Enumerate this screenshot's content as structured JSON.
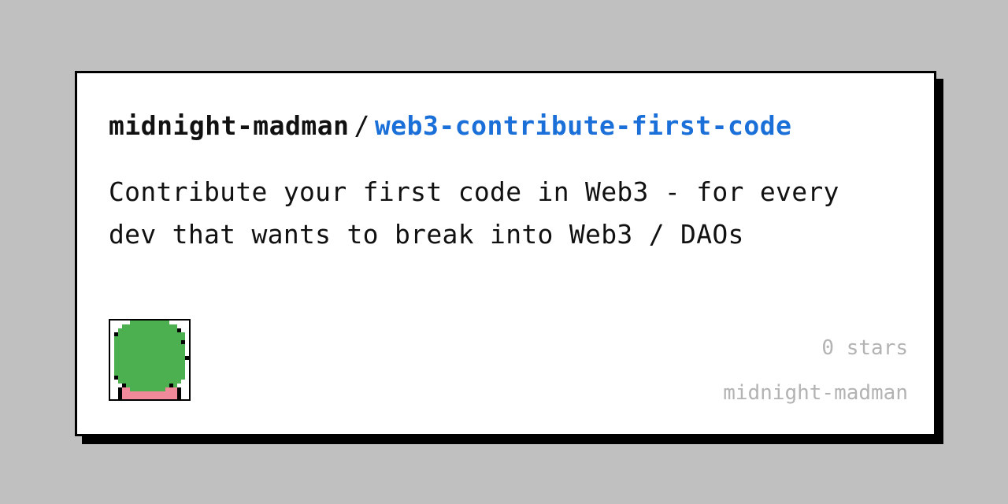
{
  "card": {
    "owner": "midnight-madman",
    "separator": "/",
    "repo_name": "web3-contribute-first-code",
    "description": "Contribute your first code in Web3 - for every dev that wants to break into Web3 / DAOs",
    "stars": "0 stars",
    "username": "midnight-madman",
    "avatar_icon": "pixel-avatar-icon"
  },
  "colors": {
    "background": "#c0c0c0",
    "card": "#ffffff",
    "border": "#000000",
    "repo_link": "#1b6fd8",
    "muted_text": "#b3b3b3",
    "avatar_green": "#4caf50",
    "avatar_pink": "#f08a9a"
  }
}
